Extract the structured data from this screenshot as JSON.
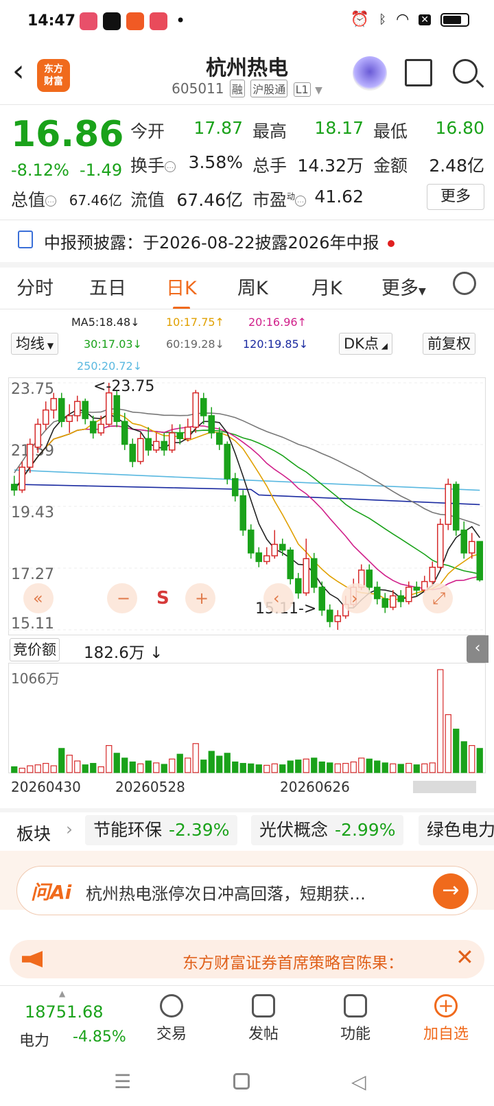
{
  "status_bar": {
    "time": "14:47",
    "dot": "•"
  },
  "header": {
    "back_icon": "back-arrow-icon",
    "logo_text_1": "东方",
    "logo_text_2": "财富",
    "stock_name": "杭州热电",
    "stock_code": "605011",
    "tag_margin": "融",
    "tag_connect": "沪股通",
    "tag_level": "L1"
  },
  "quote": {
    "price": "16.86",
    "change_pct": "-8.12%",
    "change_abs": "-1.49",
    "open_label": "今开",
    "open": "17.87",
    "high_label": "最高",
    "high": "18.17",
    "low_label": "最低",
    "low": "16.80",
    "turnover_label": "换手",
    "turnover": "3.58%",
    "volume_label": "总手",
    "volume": "14.32万",
    "amount_label": "金额",
    "amount": "2.48亿",
    "mktcap_label": "总值",
    "mktcap": "67.46亿",
    "float_label": "流值",
    "float": "67.46亿",
    "pe_label": "市盈",
    "pe_sup": "动",
    "pe": "41.62",
    "more_button": "更多"
  },
  "notice": {
    "text": "中报预披露：于2026-08-22披露2026年中报"
  },
  "tabs": [
    "分时",
    "五日",
    "日K",
    "周K",
    "月K",
    "更多"
  ],
  "active_tab": "日K",
  "ma": {
    "ma5": "MA5:18.48↓",
    "ma10": "10:17.75↑",
    "ma20": "20:16.96↑",
    "ma30": "30:17.03↓",
    "ma60": "60:19.28↓",
    "ma120": "120:19.85↓",
    "ma250": "250:20.72↓",
    "indicator_select": "均线",
    "dk_button": "DK点",
    "adjust_button": "前复权"
  },
  "chart_data": {
    "type": "candlestick",
    "y_ticks": [
      "23.75",
      "21.59",
      "19.43",
      "17.27",
      "15.11"
    ],
    "high_annotation": "<-23.75",
    "low_annotation": "15.11->",
    "x_ticks": [
      "20260430",
      "20260528",
      "20260626"
    ],
    "overlay_buttons": [
      "«",
      "−",
      "S",
      "+",
      "‹",
      "›",
      "⤢"
    ],
    "ylim": [
      15.11,
      23.75
    ],
    "candles": [
      [
        20.2,
        20.0,
        20.5,
        19.8
      ],
      [
        20.0,
        20.8,
        21.0,
        19.9
      ],
      [
        20.8,
        21.6,
        21.8,
        20.6
      ],
      [
        21.5,
        22.3,
        22.5,
        21.3
      ],
      [
        22.3,
        22.8,
        23.1,
        22.1
      ],
      [
        22.8,
        23.2,
        23.4,
        22.5
      ],
      [
        23.2,
        22.4,
        23.4,
        22.2
      ],
      [
        22.4,
        22.6,
        23.0,
        22.0
      ],
      [
        22.6,
        23.1,
        23.3,
        22.4
      ],
      [
        23.1,
        22.5,
        23.2,
        22.3
      ],
      [
        22.4,
        22.0,
        22.6,
        21.8
      ],
      [
        22.0,
        22.3,
        22.6,
        21.9
      ],
      [
        22.3,
        23.4,
        23.75,
        22.2
      ],
      [
        23.3,
        22.4,
        23.5,
        22.2
      ],
      [
        22.4,
        21.6,
        22.7,
        21.4
      ],
      [
        21.6,
        21.0,
        21.8,
        20.8
      ],
      [
        21.0,
        21.8,
        22.0,
        20.9
      ],
      [
        21.8,
        21.4,
        22.2,
        21.2
      ],
      [
        21.4,
        21.7,
        22.0,
        21.3
      ],
      [
        21.7,
        21.4,
        22.0,
        21.2
      ],
      [
        21.4,
        22.0,
        22.3,
        21.3
      ],
      [
        22.0,
        21.8,
        22.3,
        21.6
      ],
      [
        21.8,
        22.2,
        22.5,
        21.7
      ],
      [
        22.2,
        23.4,
        23.5,
        22.0
      ],
      [
        23.2,
        22.6,
        23.4,
        22.3
      ],
      [
        22.6,
        22.0,
        22.9,
        21.8
      ],
      [
        22.0,
        21.6,
        22.2,
        21.4
      ],
      [
        21.6,
        20.4,
        21.7,
        20.2
      ],
      [
        20.4,
        19.8,
        20.6,
        19.6
      ],
      [
        19.8,
        18.6,
        20.0,
        18.4
      ],
      [
        18.6,
        17.8,
        18.8,
        17.6
      ],
      [
        17.8,
        17.5,
        18.0,
        17.3
      ],
      [
        17.5,
        17.7,
        18.0,
        17.4
      ],
      [
        17.7,
        18.1,
        18.6,
        17.6
      ],
      [
        18.1,
        17.9,
        18.3,
        17.7
      ],
      [
        17.9,
        16.9,
        18.0,
        16.7
      ],
      [
        16.9,
        16.4,
        17.1,
        16.2
      ],
      [
        16.4,
        17.6,
        18.3,
        16.3
      ],
      [
        17.6,
        16.6,
        17.8,
        16.4
      ],
      [
        16.6,
        15.8,
        16.8,
        15.6
      ],
      [
        15.8,
        15.4,
        16.0,
        15.2
      ],
      [
        15.4,
        15.6,
        15.8,
        15.11
      ],
      [
        15.6,
        16.0,
        16.3,
        15.5
      ],
      [
        16.0,
        16.6,
        16.9,
        15.9
      ],
      [
        16.6,
        17.2,
        17.4,
        16.5
      ],
      [
        17.2,
        16.6,
        17.4,
        16.4
      ],
      [
        16.6,
        16.2,
        16.8,
        16.0
      ],
      [
        16.2,
        15.9,
        16.4,
        15.7
      ],
      [
        15.9,
        16.3,
        16.5,
        15.8
      ],
      [
        16.3,
        16.1,
        16.5,
        15.9
      ],
      [
        16.1,
        16.6,
        16.8,
        16.0
      ],
      [
        16.6,
        16.5,
        16.8,
        16.3
      ],
      [
        16.5,
        16.8,
        17.0,
        16.4
      ],
      [
        16.8,
        17.3,
        17.5,
        16.7
      ],
      [
        17.3,
        18.8,
        19.0,
        17.2
      ],
      [
        18.8,
        20.2,
        20.4,
        18.6
      ],
      [
        20.2,
        18.6,
        20.3,
        18.4
      ],
      [
        18.6,
        17.8,
        18.9,
        17.6
      ],
      [
        17.8,
        18.2,
        18.5,
        17.6
      ],
      [
        18.2,
        16.86,
        18.17,
        16.8
      ]
    ],
    "volumes": [
      60,
      45,
      70,
      80,
      95,
      70,
      250,
      180,
      120,
      80,
      95,
      60,
      280,
      200,
      150,
      110,
      90,
      120,
      100,
      85,
      140,
      190,
      150,
      300,
      130,
      220,
      170,
      200,
      110,
      95,
      90,
      80,
      75,
      90,
      80,
      120,
      130,
      140,
      150,
      110,
      100,
      90,
      95,
      110,
      150,
      140,
      120,
      100,
      90,
      85,
      95,
      80,
      90,
      100,
      1066,
      600,
      450,
      320,
      280,
      250
    ]
  },
  "sub_indicator": {
    "label": "竞价额",
    "value": "182.6万 ↓",
    "max_label": "1066万",
    "collapse_icon": "‹"
  },
  "sectors": {
    "label": "板块",
    "items": [
      {
        "name": "节能环保",
        "change": "-2.39%"
      },
      {
        "name": "光伏概念",
        "change": "-2.99%"
      },
      {
        "name": "绿色电力",
        "change": ""
      }
    ]
  },
  "ai": {
    "logo": "问Ai",
    "text": "杭州热电涨停次日冲高回落，短期获…",
    "go": "→"
  },
  "promo": {
    "text": "东方财富证券首席策略官陈果：",
    "close": "✕"
  },
  "bottom_nav": {
    "index_value": "18751.68",
    "index_name": "电力",
    "index_change": "-4.85%",
    "items": [
      "交易",
      "发帖",
      "功能",
      "加自选"
    ]
  }
}
